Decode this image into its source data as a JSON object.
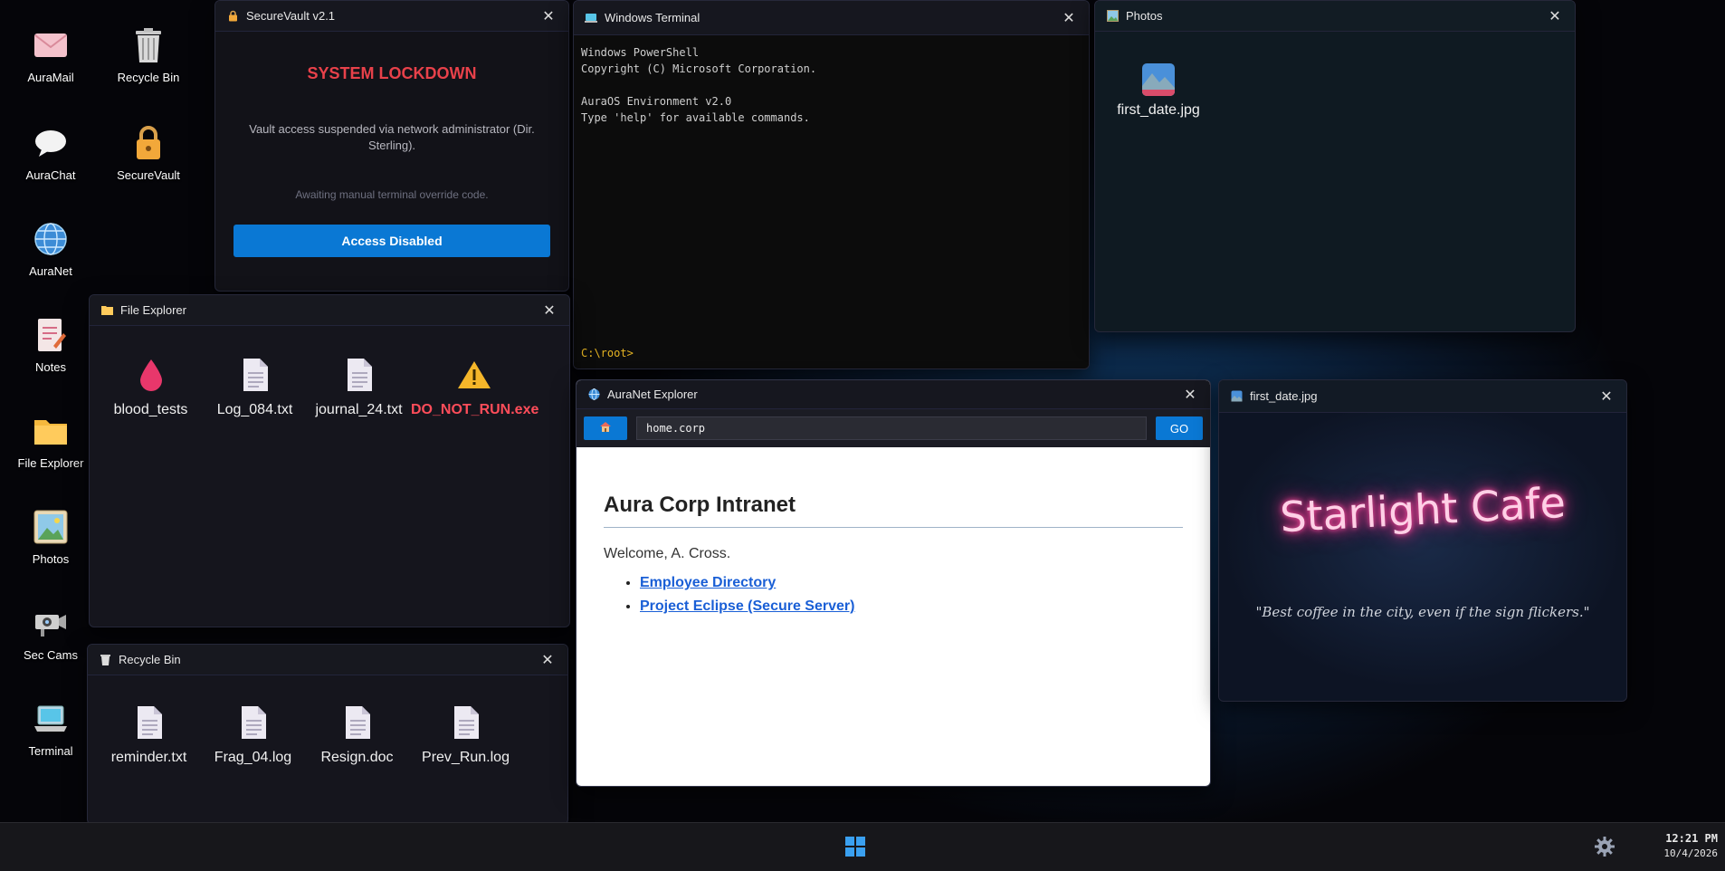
{
  "desktop": {
    "icons": [
      {
        "label": "AuraMail"
      },
      {
        "label": "Recycle Bin"
      },
      {
        "label": "AuraChat"
      },
      {
        "label": "SecureVault"
      },
      {
        "label": "AuraNet"
      },
      {
        "label": "Notes"
      },
      {
        "label": "File Explorer"
      },
      {
        "label": "Photos"
      },
      {
        "label": "Sec Cams"
      },
      {
        "label": "Terminal"
      }
    ]
  },
  "securevault": {
    "title": "SecureVault v2.1",
    "heading": "SYSTEM LOCKDOWN",
    "message": "Vault access suspended via network administrator (Dir. Sterling).",
    "status": "Awaiting manual terminal override code.",
    "button": "Access Disabled",
    "colors": {
      "heading": "#e8414a",
      "button": "#0a78d4"
    }
  },
  "terminal": {
    "title": "Windows Terminal",
    "lines": [
      "Windows PowerShell",
      "Copyright (C) Microsoft Corporation.",
      "",
      "AuraOS Environment v2.0",
      "Type 'help' for available commands."
    ],
    "prompt": "C:\\root>"
  },
  "photos": {
    "title": "Photos",
    "files": [
      {
        "name": "first_date.jpg"
      }
    ]
  },
  "file_explorer": {
    "title": "File Explorer",
    "files": [
      {
        "name": "blood_tests",
        "icon": "blood-drop-icon"
      },
      {
        "name": "Log_084.txt",
        "icon": "document-icon"
      },
      {
        "name": "journal_24.txt",
        "icon": "document-icon"
      },
      {
        "name": "DO_NOT_RUN.exe",
        "icon": "warning-icon"
      }
    ]
  },
  "recycle_bin": {
    "title": "Recycle Bin",
    "files": [
      {
        "name": "reminder.txt"
      },
      {
        "name": "Frag_04.log"
      },
      {
        "name": "Resign.doc"
      },
      {
        "name": "Prev_Run.log"
      }
    ]
  },
  "auranet": {
    "title": "AuraNet Explorer",
    "address": "home.corp",
    "go": "GO",
    "page_title": "Aura Corp Intranet",
    "welcome": "Welcome, A. Cross.",
    "links": [
      "Employee Directory",
      "Project Eclipse (Secure Server)"
    ]
  },
  "photo_viewer": {
    "title": "first_date.jpg",
    "sign": "Starlight Cafe",
    "caption": "\"Best coffee in the city, even if the sign flickers.\""
  },
  "taskbar": {
    "time": "12:21 PM",
    "date": "10/4/2026"
  }
}
